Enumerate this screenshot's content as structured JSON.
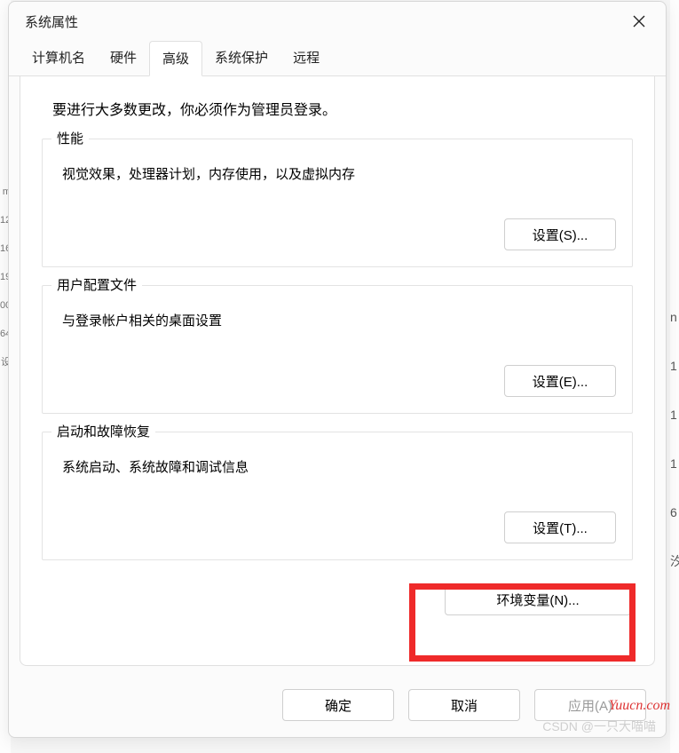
{
  "window": {
    "title": "系统属性"
  },
  "tabs": [
    {
      "label": "计算机名"
    },
    {
      "label": "硬件"
    },
    {
      "label": "高级"
    },
    {
      "label": "系统保护"
    },
    {
      "label": "远程"
    }
  ],
  "intro": "要进行大多数更改，你必须作为管理员登录。",
  "groups": {
    "performance": {
      "title": "性能",
      "desc": "视觉效果，处理器计划，内存使用，以及虚拟内存",
      "button": "设置(S)..."
    },
    "userprofile": {
      "title": "用户配置文件",
      "desc": "与登录帐户相关的桌面设置",
      "button": "设置(E)..."
    },
    "startup": {
      "title": "启动和故障恢复",
      "desc": "系统启动、系统故障和调试信息",
      "button": "设置(T)..."
    }
  },
  "env_button": "环境变量(N)...",
  "footer": {
    "ok": "确定",
    "cancel": "取消",
    "apply": "应用(A)"
  },
  "backdrop_left": [
    "m",
    "12",
    "16",
    "19",
    "00",
    "64",
    "设"
  ],
  "backdrop_right": [
    "n",
    "1",
    "1",
    "1",
    "6",
    "汐"
  ],
  "watermarks": {
    "yuucn": "Yuucn.com",
    "csdn": "CSDN @一只大喵喵"
  }
}
